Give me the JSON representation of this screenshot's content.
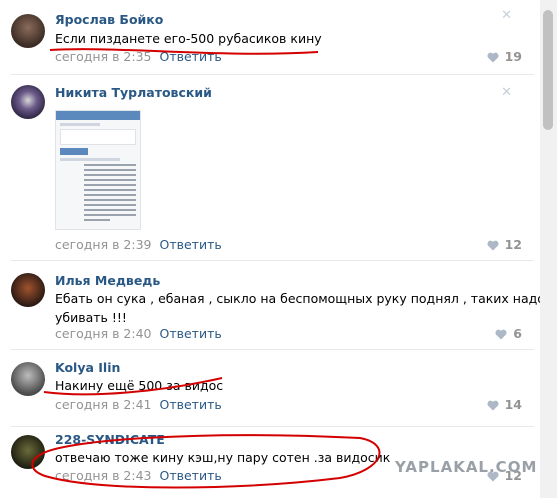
{
  "reply_label": "Ответить",
  "comments": [
    {
      "author": "Ярослав Бойко",
      "text": "Если пизданете его-500 рубасиков кину",
      "time": "сегодня в 2:35",
      "likes": "19"
    },
    {
      "author": "Никита Турлатовский",
      "text": "",
      "time": "сегодня в 2:39",
      "likes": "12"
    },
    {
      "author": "Илья Медведь",
      "text_line1": "Ебать он сука , ебаная , сыкло на беспомощных руку поднял , таких надо",
      "text_line2": "убивать !!!",
      "time": "сегодня в 2:40",
      "likes": "6"
    },
    {
      "author": "Kolya Ilin",
      "text": "Накину ещё 500 за видос",
      "time": "сегодня в 2:41",
      "likes": "14"
    },
    {
      "author": "228-SYNDICATE",
      "text": "отвечаю тоже кину кэш,ну пару сотен .за видосик",
      "time": "сегодня в 2:43",
      "likes": "12"
    }
  ],
  "watermark": "YAPLAKAL.COM",
  "colors": {
    "link": "#2a5885",
    "meta": "#939393",
    "annotation": "#d40000"
  }
}
